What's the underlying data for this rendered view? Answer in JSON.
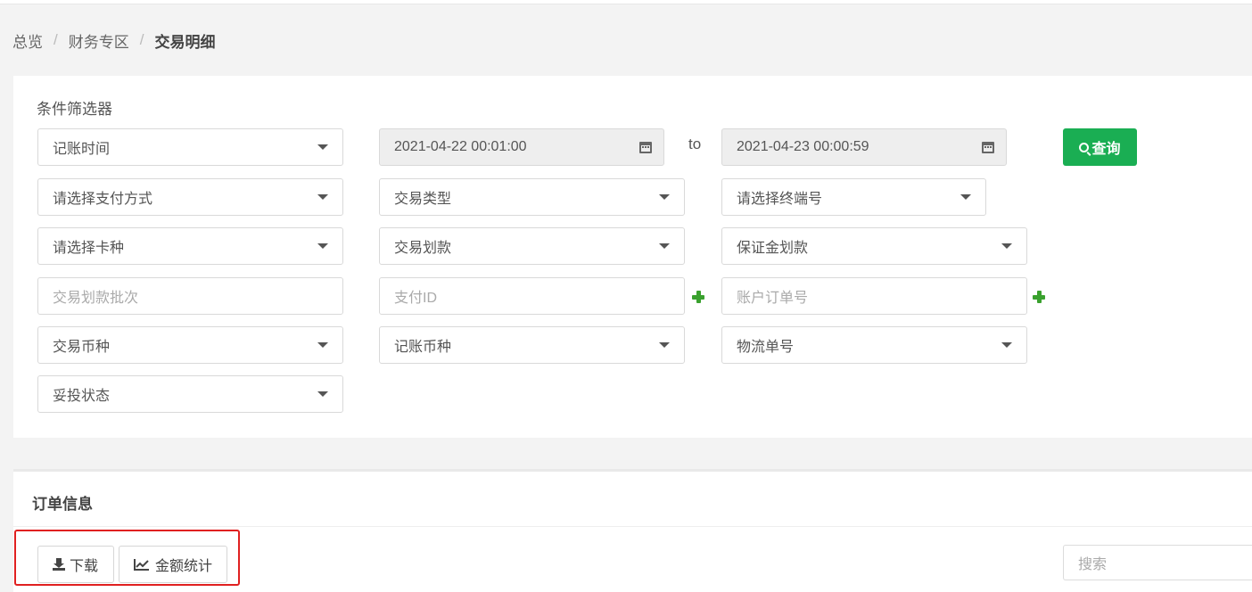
{
  "breadcrumb": {
    "home": "总览",
    "section": "财务专区",
    "current": "交易明细",
    "separator": "/"
  },
  "filters": {
    "title": "条件筛选器",
    "date_field": "记账时间",
    "start_date": "2021-04-22 00:01:00",
    "to_label": "to",
    "end_date": "2021-04-23 00:00:59",
    "query_button": "查询",
    "payment_method": "请选择支付方式",
    "trade_type": "交易类型",
    "terminal": "请选择终端号",
    "card_type": "请选择卡种",
    "trade_transfer": "交易划款",
    "deposit_transfer": "保证金划款",
    "transfer_batch_placeholder": "交易划款批次",
    "payment_id_placeholder": "支付ID",
    "account_order_placeholder": "账户订单号",
    "trade_currency": "交易币种",
    "booking_currency": "记账币种",
    "logistics_no": "物流单号",
    "delivery_status": "妥投状态"
  },
  "orders": {
    "title": "订单信息",
    "download_button": "下载",
    "amount_stats_button": "金额统计",
    "search_placeholder": "搜索"
  },
  "colors": {
    "accent": "#1aae53",
    "plus": "#3aa12e",
    "highlight": "#e02020"
  },
  "icons": [
    "calendar-icon",
    "search-icon",
    "plus-icon",
    "download-icon",
    "line-chart-icon",
    "caret-down-icon"
  ]
}
